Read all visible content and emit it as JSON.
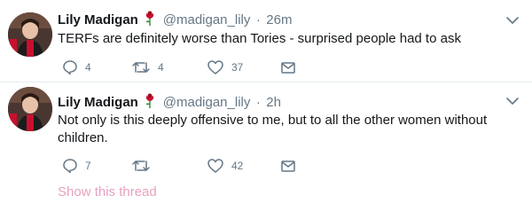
{
  "tweets": [
    {
      "name": "Lily Madigan",
      "handle": "@madigan_lily",
      "separator": "·",
      "time": "26m",
      "text": "TERFs are definitely worse than Tories - surprised people had to ask",
      "reply_count": "4",
      "retweet_count": "4",
      "like_count": "37"
    },
    {
      "name": "Lily Madigan",
      "handle": "@madigan_lily",
      "separator": "·",
      "time": "2h",
      "text": "Not only is this deeply offensive to me, but to all the other women without children.",
      "reply_count": "7",
      "retweet_count": "",
      "like_count": "42",
      "show_thread": "Show this thread"
    }
  ],
  "icons": {
    "emoji": "rose-icon",
    "reply": "reply-icon",
    "retweet": "retweet-icon",
    "like": "heart-icon",
    "message": "envelope-icon",
    "menu": "chevron-down-icon"
  },
  "colors": {
    "text": "#14171a",
    "secondary": "#657786",
    "icon": "#657786",
    "divider": "#e6ecf0",
    "show_thread": "#e8a1c0",
    "rose": "#c8102e"
  }
}
